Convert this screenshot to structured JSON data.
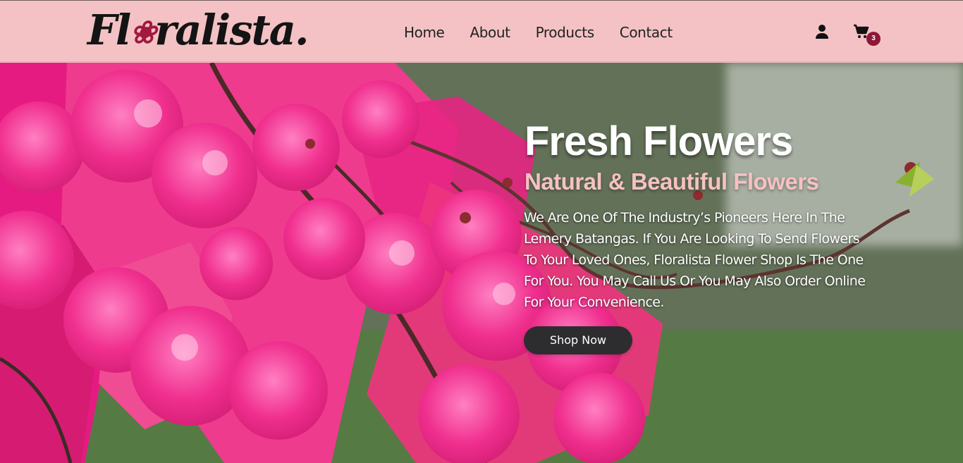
{
  "brand": {
    "name": "Floralista."
  },
  "nav": {
    "items": [
      "Home",
      "About",
      "Products",
      "Contact"
    ]
  },
  "actions": {
    "user_icon": "user-icon",
    "cart_icon": "shopping-cart-icon",
    "cart_count": "3"
  },
  "hero": {
    "title": "Fresh Flowers",
    "subtitle": "Natural & Beautiful Flowers",
    "description": "We Are One Of The Industry’s Pioneers Here In The Lemery Batangas. If You Are Looking To Send Flowers To Your Loved Ones, Floralista Flower Shop Is The One For You. You May Call Us Or You May Also Order Online For Your Convenience.",
    "button": "Shop Now"
  },
  "colors": {
    "header_background": "#f4c2c4",
    "brand_rose": "#a2183e",
    "badge": "#8d1737",
    "button": "#2d2d2f",
    "hero_subtitle": "#f6c1c3"
  }
}
